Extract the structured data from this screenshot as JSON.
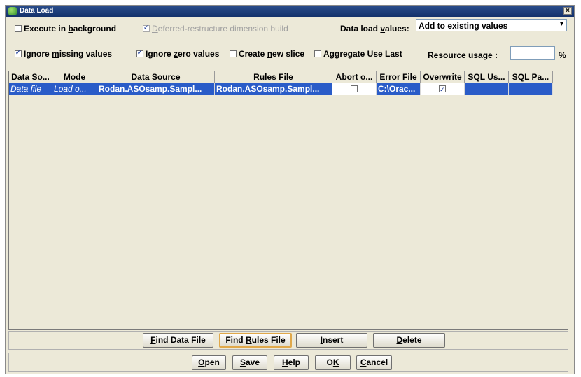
{
  "window": {
    "title": "Data Load",
    "close_glyph": "×"
  },
  "options": {
    "execute_background": {
      "label_pre": "Execute in ",
      "label_ul": "b",
      "label_post": "ackground",
      "checked": false
    },
    "deferred_restructure": {
      "label_pre": "",
      "label_ul": "D",
      "label_post": "eferred-restructure dimension build",
      "checked": true,
      "disabled": true
    },
    "data_load_values": {
      "label_pre": "Data load ",
      "label_ul": "v",
      "label_post": "alues:",
      "selected": "Add to existing values"
    },
    "ignore_missing": {
      "label_pre": "Ignore ",
      "label_ul": "m",
      "label_post": "issing values",
      "checked": true
    },
    "ignore_zero": {
      "label_pre": "Ignore ",
      "label_ul": "z",
      "label_post": "ero values",
      "checked": true
    },
    "create_slice": {
      "label_pre": "Create ",
      "label_ul": "n",
      "label_post": "ew slice",
      "checked": false
    },
    "aggregate_last": {
      "label": "Aggregate Use Last",
      "checked": false
    },
    "resource_usage": {
      "label_pre": "Reso",
      "label_ul": "u",
      "label_post": "rce usage :",
      "value": "",
      "unit": "%"
    }
  },
  "grid": {
    "columns": [
      "Data So...",
      "Mode",
      "Data Source",
      "Rules File",
      "Abort o...",
      "Error File",
      "Overwrite",
      "SQL Us...",
      "SQL Pa..."
    ],
    "rows": [
      {
        "data_source_type": "Data file",
        "mode": "Load o...",
        "data_source": "Rodan.ASOsamp.Sampl...",
        "rules_file": "Rodan.ASOsamp.Sampl...",
        "abort_on_error": false,
        "error_file": "C:\\Orac...",
        "overwrite": true,
        "sql_user": "",
        "sql_password": ""
      }
    ]
  },
  "buttons_row1": {
    "find_data_file": {
      "pre": "",
      "ul": "F",
      "post": "ind Data File"
    },
    "find_rules_file": {
      "pre": "Find ",
      "ul": "R",
      "post": "ules File"
    },
    "insert": {
      "pre": "",
      "ul": "I",
      "post": "nsert"
    },
    "delete": {
      "pre": "",
      "ul": "D",
      "post": "elete"
    }
  },
  "buttons_row2": {
    "open": {
      "pre": "",
      "ul": "O",
      "post": "pen"
    },
    "save": {
      "pre": "",
      "ul": "S",
      "post": "ave"
    },
    "help": {
      "pre": "",
      "ul": "H",
      "post": "elp"
    },
    "ok": {
      "pre": "O",
      "ul": "K",
      "post": ""
    },
    "cancel": {
      "pre": "",
      "ul": "C",
      "post": "ancel"
    }
  }
}
